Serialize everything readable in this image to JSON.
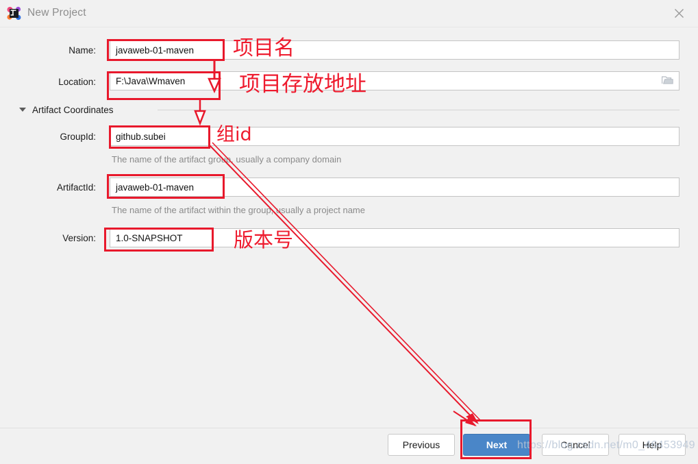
{
  "window": {
    "title": "New Project",
    "app_icon": "intellij-idea-icon",
    "close_icon": "close-icon"
  },
  "form": {
    "name": {
      "label": "Name:",
      "value": "javaweb-01-maven"
    },
    "location": {
      "label": "Location:",
      "value": "F:\\Java\\Wmaven",
      "browse_icon": "folder-icon"
    },
    "section": {
      "title": "Artifact Coordinates",
      "toggle_icon": "chevron-down-icon",
      "expanded": true
    },
    "group_id": {
      "label": "GroupId:",
      "value": "github.subei",
      "hint": "The name of the artifact group, usually a company domain"
    },
    "artifact_id": {
      "label": "ArtifactId:",
      "value": "javaweb-01-maven",
      "hint": "The name of the artifact within the group, usually a project name"
    },
    "version": {
      "label": "Version:",
      "value": "1.0-SNAPSHOT"
    }
  },
  "buttons": {
    "previous": "Previous",
    "next": "Next",
    "cancel": "Cancel",
    "help": "Help"
  },
  "annotations": {
    "project_name": "项目名",
    "project_location": "项目存放地址",
    "group_id": "组id",
    "version": "版本号",
    "accent_color": "#e8192c"
  },
  "watermark": "https://blog.csdn.net/m0_46453949"
}
